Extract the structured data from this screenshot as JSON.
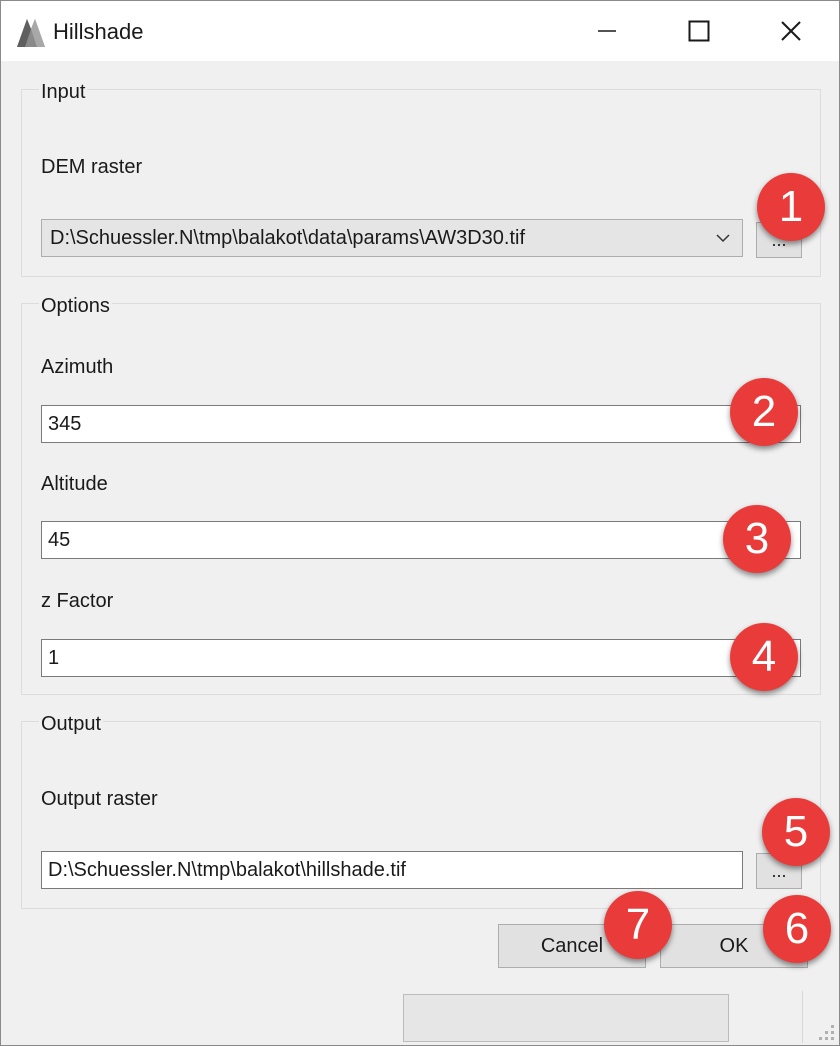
{
  "window": {
    "title": "Hillshade",
    "icon": "mountain-icon"
  },
  "window_controls": {
    "minimize_icon": "minimize-icon",
    "maximize_icon": "maximize-icon",
    "close_icon": "close-icon"
  },
  "input_group": {
    "title": "Input",
    "dem_label": "DEM raster",
    "dem_value": "D:\\Schuessler.N\\tmp\\balakot\\data\\params\\AW3D30.tif",
    "browse_label": "..."
  },
  "options_group": {
    "title": "Options",
    "azimuth_label": "Azimuth",
    "azimuth_value": "345",
    "altitude_label": "Altitude",
    "altitude_value": "45",
    "zfactor_label": "z Factor",
    "zfactor_value": "1"
  },
  "output_group": {
    "title": "Output",
    "output_label": "Output raster",
    "output_value": "D:\\Schuessler.N\\tmp\\balakot\\hillshade.tif",
    "browse_label": "..."
  },
  "buttons": {
    "cancel": "Cancel",
    "ok": "OK"
  },
  "annotations": [
    "1",
    "2",
    "3",
    "4",
    "5",
    "6",
    "7"
  ],
  "colors": {
    "badge": "#e93c3a",
    "window_bg": "#f0f0f0"
  }
}
